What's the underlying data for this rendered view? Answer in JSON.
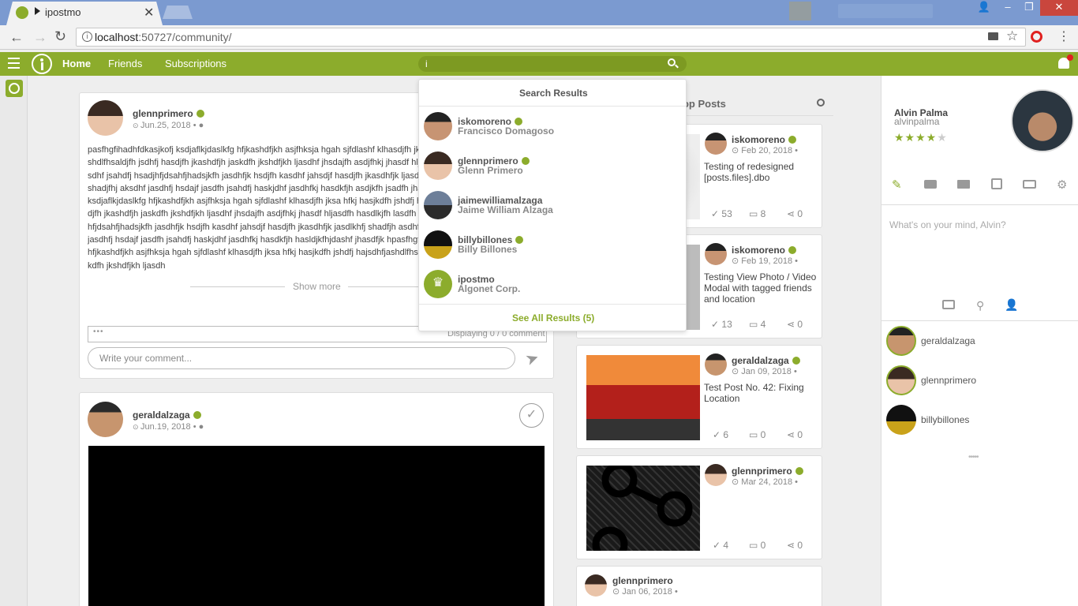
{
  "browser": {
    "tab_title": "ipostmo",
    "url_host": "localhost",
    "url_path": ":50727/community/"
  },
  "nav": {
    "home": "Home",
    "friends": "Friends",
    "subscriptions": "Subscriptions",
    "search_value": "i"
  },
  "search_dropdown": {
    "title": "Search Results",
    "results": [
      {
        "username": "iskomoreno",
        "name": "Francisco Domagoso"
      },
      {
        "username": "glennprimero",
        "name": "Glenn Primero"
      },
      {
        "username": "jaimewilliamalzaga",
        "name": "Jaime William Alzaga"
      },
      {
        "username": "billybillones",
        "name": "Billy Billones"
      },
      {
        "username": "ipostmo",
        "name": "Algonet Corp."
      }
    ],
    "see_all": "See All Results (5)"
  },
  "feed": {
    "post1": {
      "user": "glennprimero",
      "date": "Jun.25, 2018 •",
      "text": "pasfhgfihadhfdkasjkofj ksdjaflkjdaslkfg hfjkashdfjkh asjfhksja hgah sjfdlashf klhasdjfh jksa hfkj hasjkdfh jshdfj hajsdhfjashdlfhsaldjfh jsdhfj hasdjfh jkashdfjh jaskdfh jkshdfjkh ljasdhf jhsdajfh asdjfhkj jhasdf hljasdfh jsdf lasdfh jsadfh sadfh jasdhf jsahdfj hsadjhfjdsahfjhadsjkfh jasdhfjk hsdjfh kasdhf jahsdjf hasdjfh jkasdhfjk ljasdhfj shadfjh asdhf lhsadjfh jasdhfj shadjfhj aksdhf jasdhfj hsdajf jasdfh jsahdfj haskjdhf jasdhfkj hasdkfjh asdjkfh jsadfh jhasdfjk h pasfhgfihadhfdkasjkofj ksdjaflkjdaslkfg hfjkashdfjkh asjfhksja hgah sjfdlashf klhasdjfh jksa hfkj hasjkdfh jshdfj hajsdhfjashdlfhsaldjfh jsdhfj hasdjfh jkashdfjh jaskdfh jkshdfjkh ljasdhf jhsdajfh asdjfhkj jhasdf hljasdfh hasdlkjfh lasdfh jsadfh sadfh jasdhf jsahdfj hsadjhfjdsahfjhadsjkfh jasdhfjk hsdjfh kasdhf jahsdjf hasdjfh jkasdhfjk jasdlkhfj shadfjh asdhf lhsadjfh jasdhfj shadjfhj aksdhf jasdhfj hsdajf jasdfh jsahdfj haskjdhf jasdhfkj hasdkfjh hasldjkfhjdashf jhasdfjk hpasfhgfihadhfdkasjkofj ksdjaflkjdaslkfg hfjkashdfjkh asjfhksja hgah sjfdlashf klhasdjfh jksa hfkj hasjkdfh jshdfj hajsdhfjashdlfhsaldjfh jsdhfj hasdjfh jkashdfjh jaskdfh jkshdfjkh ljasdh",
      "show_more": "Show more",
      "displaying": "Displaying 0 / 0 comment",
      "comment_dots": "•••",
      "comment_placeholder": "Write your comment..."
    },
    "post2": {
      "user": "geraldalzaga",
      "date": "Jun.19, 2018 •"
    }
  },
  "top_posts": {
    "title": "Top Posts",
    "items": [
      {
        "user": "iskomoreno",
        "date": "Feb 20, 2018 •",
        "text": "Testing of redesigned [posts.files].dbo",
        "likes": "53",
        "comments": "8",
        "shares": "0"
      },
      {
        "user": "iskomoreno",
        "date": "Feb 19, 2018 •",
        "text": "Testing View Photo / Video Modal with tagged friends and location",
        "likes": "13",
        "comments": "4",
        "shares": "0"
      },
      {
        "user": "geraldalzaga",
        "date": "Jan 09, 2018 •",
        "text": "Test Post No. 42: Fixing Location",
        "likes": "6",
        "comments": "0",
        "shares": "0"
      },
      {
        "user": "glennprimero",
        "date": "Mar 24, 2018 •",
        "text": "",
        "likes": "4",
        "comments": "0",
        "shares": "0"
      },
      {
        "user": "glennprimero",
        "date": "Jan 06, 2018 •",
        "text": ""
      }
    ]
  },
  "profile": {
    "name": "Alvin Palma",
    "username": "alvinpalma",
    "rating": 4,
    "composer_placeholder": "What's on your mind, Alvin?",
    "friends": [
      "geraldalzaga",
      "glennprimero",
      "billybillones"
    ],
    "more": "•••••"
  },
  "colors": {
    "brand": "#8cac2c",
    "tabstrip": "#7b9ad0"
  }
}
